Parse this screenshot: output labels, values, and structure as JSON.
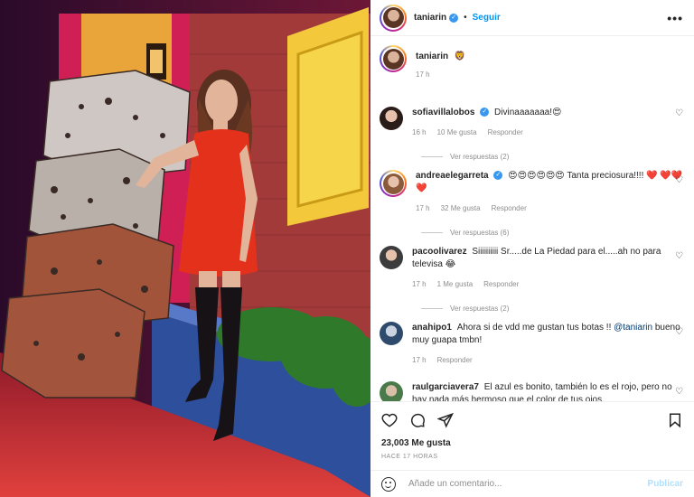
{
  "post": {
    "author": "taniarin",
    "follow_label": "Seguir",
    "more_label": "•••",
    "caption_text": "🦁",
    "caption_time": "17 h"
  },
  "comments": [
    {
      "username": "sofiavillalobos",
      "verified": true,
      "text": "Divinaaaaaaa!😍",
      "time": "16 h",
      "likes": "10 Me gusta",
      "reply": "Responder",
      "replies": "Ver respuestas (2)"
    },
    {
      "username": "andreaelegarreta",
      "verified": true,
      "text": "😍😍😍😍😍😍 Tanta preciosura!!!! ❤️ ❤️❤️❤️",
      "time": "17 h",
      "likes": "32 Me gusta",
      "reply": "Responder",
      "replies": "Ver respuestas (6)"
    },
    {
      "username": "pacoolivarez",
      "verified": false,
      "text": "Siiiiiiiiii Sr.....de La Piedad para el.....ah no para televisa 😂",
      "time": "17 h",
      "likes": "1 Me gusta",
      "reply": "Responder",
      "replies": "Ver respuestas (2)"
    },
    {
      "username": "anahipo1",
      "verified": false,
      "text_before": "Ahora si de vdd me gustan tus botas !! ",
      "mention": "@taniarin",
      "text_after": " bueno muy guapa tmbn!",
      "time": "17 h",
      "reply": "Responder"
    },
    {
      "username": "raulgarciavera7",
      "verified": false,
      "text": "El azul es bonito, también lo es el rojo, pero no hay nada más hermoso que el color de tus ojos."
    }
  ],
  "actions": {
    "likes": "23,003 Me gusta",
    "time_ago": "HACE 17 HORAS"
  },
  "add_comment": {
    "placeholder": "Añade un comentario...",
    "publish_label": "Publicar"
  },
  "colors": {
    "link_blue": "#0095f6",
    "verified_blue": "#3897f0",
    "muted": "#8e8e8e",
    "publish_disabled": "#b2dffc"
  }
}
